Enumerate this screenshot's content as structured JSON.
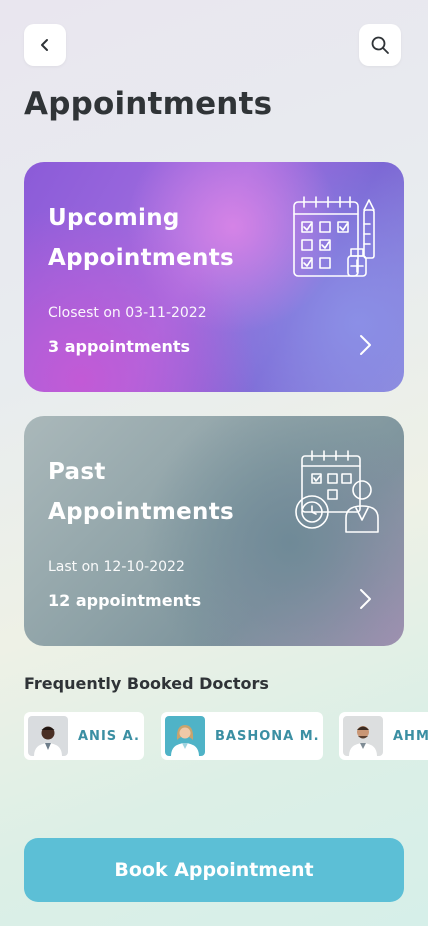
{
  "header": {
    "back_icon": "chevron-left-icon",
    "search_icon": "search-icon",
    "title": "Appointments"
  },
  "cards": {
    "upcoming": {
      "title": "Upcoming Appointments",
      "subtitle": "Closest on 03-11-2022",
      "count": "3 appointments",
      "icon": "calendar-checklist-icon"
    },
    "past": {
      "title": "Past Appointments",
      "subtitle": "Last on 12-10-2022",
      "count": "12 appointments",
      "icon": "calendar-doctor-icon"
    }
  },
  "doctors": {
    "title": "Frequently Booked Doctors",
    "items": [
      {
        "name": "ANIS A."
      },
      {
        "name": "BASHONA M."
      },
      {
        "name": "AHMED"
      }
    ]
  },
  "book_button": "Book Appointment",
  "colors": {
    "accent": "#5cbfd6",
    "doctor_name": "#3b8fa3",
    "title": "#303437"
  }
}
